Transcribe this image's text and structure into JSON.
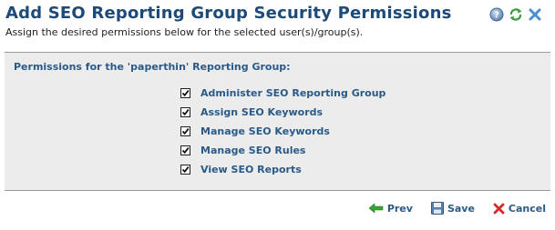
{
  "header": {
    "title": "Add SEO Reporting Group Security Permissions",
    "subtitle": "Assign the desired permissions below for the selected user(s)/group(s).",
    "icons": [
      "help-icon",
      "refresh-icon",
      "close-icon"
    ]
  },
  "permissions": {
    "group_label": "Permissions for the 'paperthin' Reporting Group:",
    "items": [
      {
        "label": "Administer SEO Reporting Group",
        "checked": true
      },
      {
        "label": "Assign SEO Keywords",
        "checked": true
      },
      {
        "label": "Manage SEO Keywords",
        "checked": true
      },
      {
        "label": "Manage SEO Rules",
        "checked": true
      },
      {
        "label": "View SEO Reports",
        "checked": true
      }
    ]
  },
  "footer": {
    "prev_label": "Prev",
    "save_label": "Save",
    "cancel_label": "Cancel"
  },
  "colors": {
    "title": "#1d4a78",
    "link": "#2a5a87",
    "panel_bg": "#ececec",
    "prev_arrow": "#3aa03a",
    "cancel_x": "#d42a2a"
  }
}
